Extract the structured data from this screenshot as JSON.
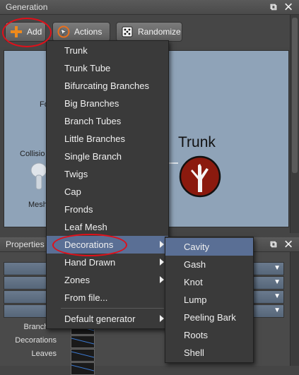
{
  "generation_panel": {
    "title": "Generation",
    "window_buttons": "⧉ ✕"
  },
  "toolbar": {
    "add_label": "Add",
    "actions_label": "Actions",
    "randomize_label": "Randomize"
  },
  "canvas": {
    "trunk_node_label": "Trunk",
    "left_labels": [
      "Fo",
      "Collisio",
      "Mesh"
    ]
  },
  "properties_panel": {
    "title": "Properties -",
    "window_buttons": "⧉ ✕",
    "rows": [
      "Branches",
      "Decorations",
      "Leaves"
    ]
  },
  "add_menu": {
    "items": [
      {
        "label": "Trunk"
      },
      {
        "label": "Trunk Tube"
      },
      {
        "label": "Bifurcating Branches"
      },
      {
        "label": "Big Branches"
      },
      {
        "label": "Branch Tubes"
      },
      {
        "label": "Little Branches"
      },
      {
        "label": "Single Branch"
      },
      {
        "label": "Twigs"
      },
      {
        "label": "Cap"
      },
      {
        "label": "Fronds"
      },
      {
        "label": "Leaf Mesh"
      },
      {
        "label": "Decorations"
      },
      {
        "label": "Hand Drawn"
      },
      {
        "label": "Zones"
      },
      {
        "label": "From file..."
      },
      {
        "label": "Default generator"
      }
    ]
  },
  "decorations_submenu": {
    "items": [
      {
        "label": "Cavity"
      },
      {
        "label": "Gash"
      },
      {
        "label": "Knot"
      },
      {
        "label": "Lump"
      },
      {
        "label": "Peeling Bark"
      },
      {
        "label": "Roots"
      },
      {
        "label": "Shell"
      }
    ]
  },
  "colors": {
    "highlight": "#5a6f95",
    "annotation_circle": "#e0101a",
    "trunk_node": "#8b1a0e"
  }
}
